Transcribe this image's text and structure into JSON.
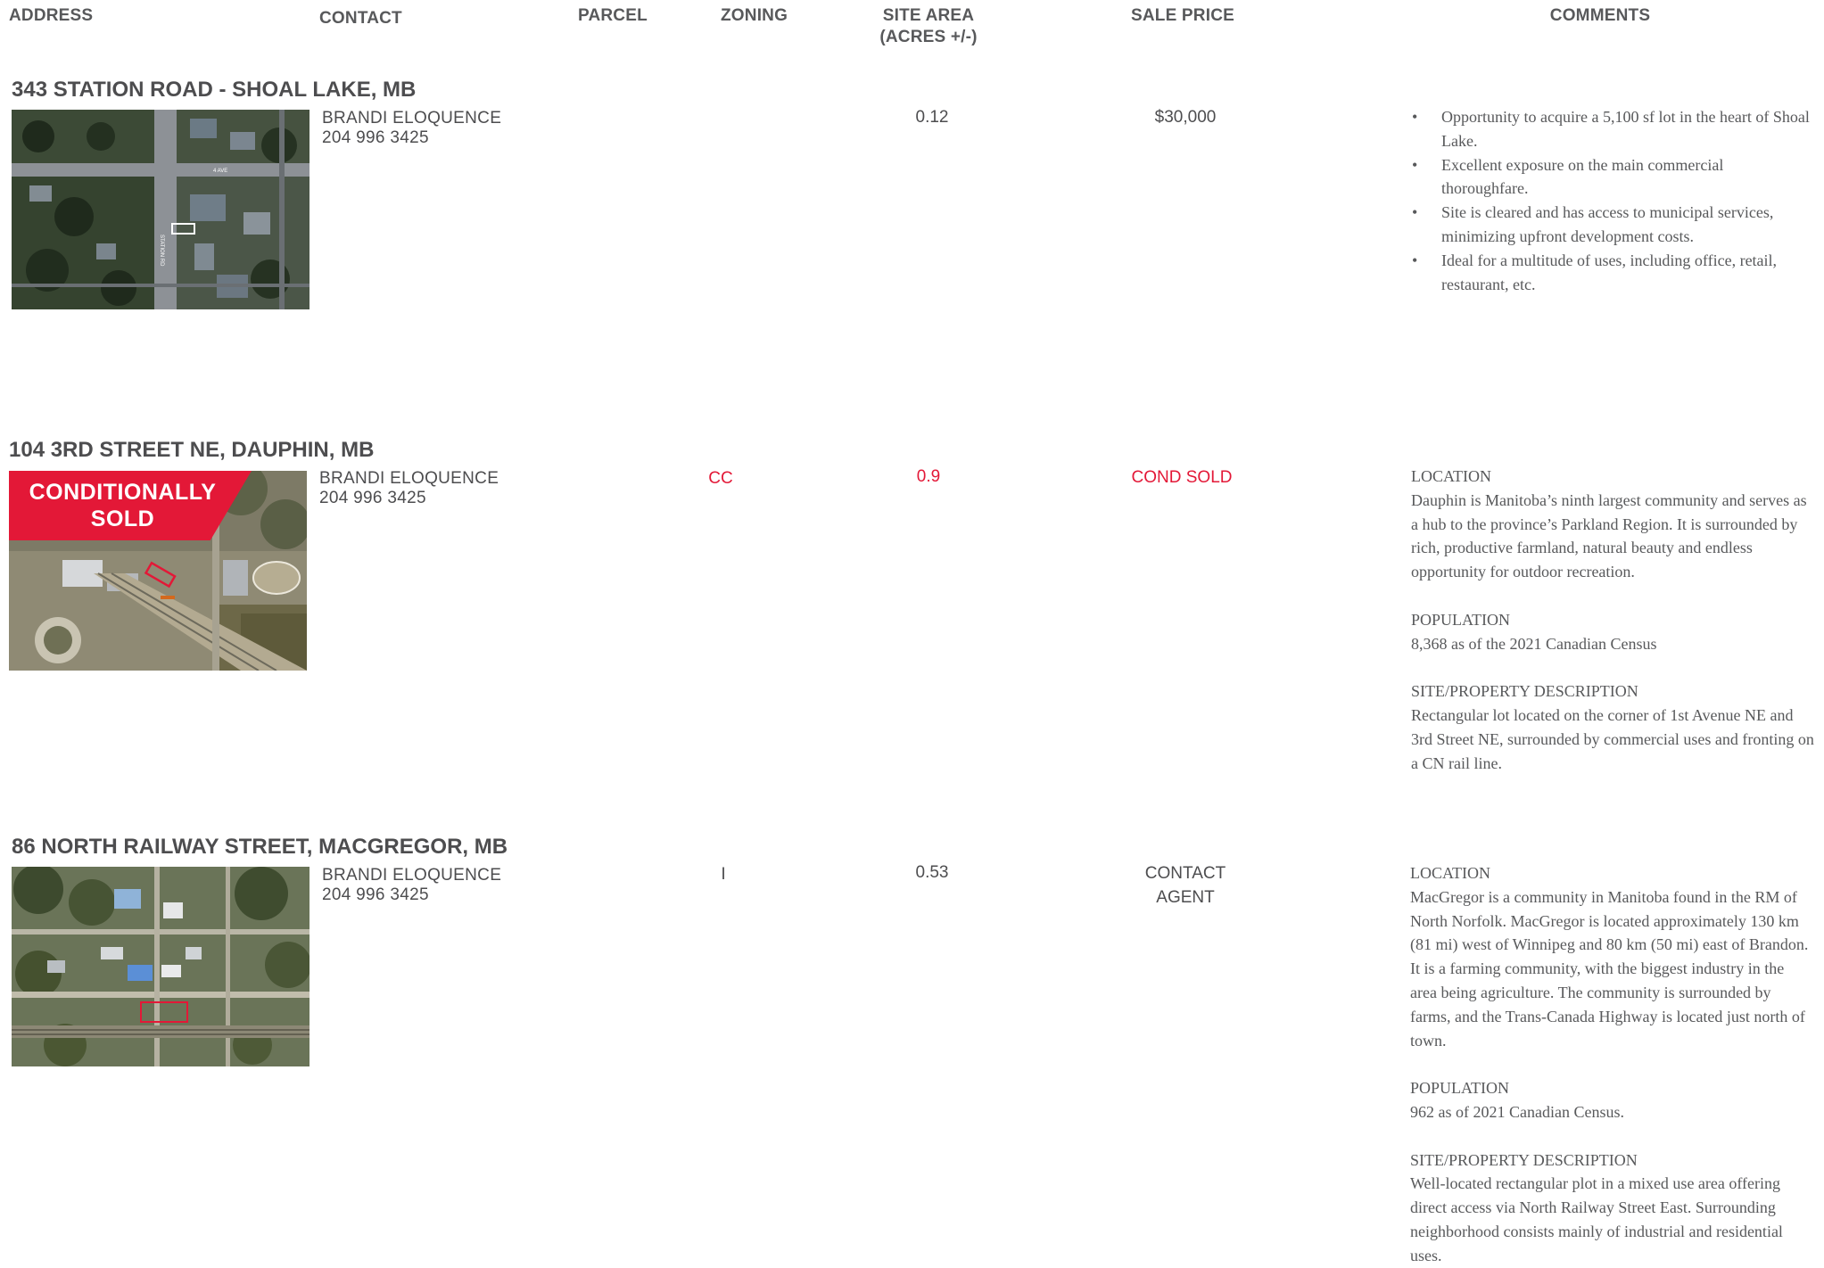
{
  "header": {
    "address": "ADDRESS",
    "contact": "CONTACT",
    "parcel": "PARCEL",
    "zoning": "ZONING",
    "site_area_line1": "SITE AREA",
    "site_area_line2": "(ACRES +/-)",
    "sale_price": "SALE PRICE",
    "comments": "COMMENTS"
  },
  "listings": [
    {
      "address": "343 STATION ROAD - SHOAL LAKE, MB",
      "contact_name": "BRANDI ELOQUENCE",
      "contact_phone": "204 996 3425",
      "parcel": "",
      "zoning": "",
      "site_area": "0.12",
      "sale_price": "$30,000",
      "map_labels": [
        "4 AVE",
        "STATION RD"
      ],
      "comments_bullets": [
        "Opportunity to acquire a 5,100 sf lot in the heart of Shoal Lake.",
        "Excellent exposure on the main commercial thoroughfare.",
        "Site is cleared and has access to municipal services, minimizing upfront development costs.",
        "Ideal for a multitude of uses, including office, retail, restaurant, etc."
      ]
    },
    {
      "address": "104 3RD STREET NE, DAUPHIN, MB",
      "ribbon_line1": "CONDITIONALLY",
      "ribbon_line2": "SOLD",
      "contact_name": "BRANDI ELOQUENCE",
      "contact_phone": "204 996 3425",
      "parcel": "",
      "zoning": "CC",
      "site_area": "0.9",
      "sale_price": "COND SOLD",
      "status_color": "#e31837",
      "comments_sections": [
        {
          "heading": "LOCATION",
          "text": "Dauphin is Manitoba’s ninth largest community and serves as a hub to the province’s Parkland Region. It is surrounded by rich, productive farmland, natural beauty and endless opportunity for outdoor recreation."
        },
        {
          "heading": "POPULATION",
          "text": "8,368 as of the 2021 Canadian Census"
        },
        {
          "heading": "SITE/PROPERTY DESCRIPTION",
          "text": "Rectangular lot located on the corner of 1st Avenue NE and 3rd Street NE, surrounded by commercial uses and fronting on a CN rail line."
        }
      ]
    },
    {
      "address": "86 NORTH RAILWAY STREET, MACGREGOR, MB",
      "contact_name": "BRANDI ELOQUENCE",
      "contact_phone": "204 996 3425",
      "parcel": "",
      "zoning": "I",
      "site_area": "0.53",
      "sale_price_line1": "CONTACT",
      "sale_price_line2": "AGENT",
      "comments_sections": [
        {
          "heading": "LOCATION",
          "text": "MacGregor is a community in Manitoba found in the RM of North Norfolk. MacGregor is located approxi­mately 130 km (81 mi) west of Winnipeg and 80 km (50 mi) east of Brandon. It is a farming community, with the biggest industry in the area being agriculture. The community is surrounded by farms, and the Trans-Canada Highway is located just north of town."
        },
        {
          "heading": "POPULATION",
          "text": "962 as of 2021 Canadian Census."
        },
        {
          "heading": "SITE/PROPERTY DESCRIPTION",
          "text": "Well-located rectangular plot in a mixed use area offering direct access via North Railway Street East. Surrounding neighborhood consists mainly of industrial and residential uses."
        }
      ]
    }
  ],
  "colors": {
    "text": "#58595b",
    "accent_red": "#e31837"
  }
}
